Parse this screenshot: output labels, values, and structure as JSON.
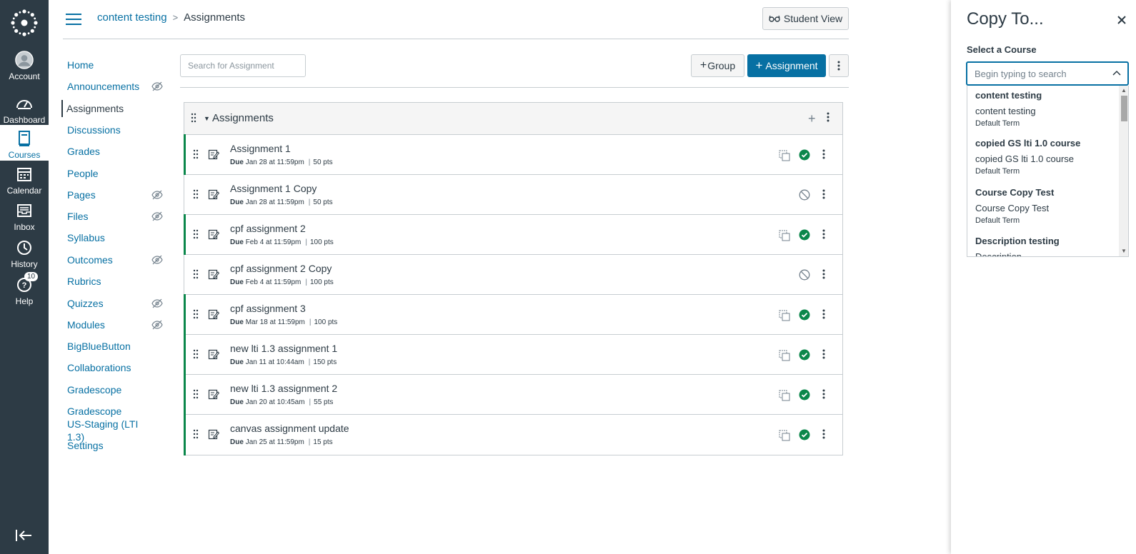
{
  "global_nav": {
    "items": [
      {
        "label": "Account",
        "icon": "account-icon"
      },
      {
        "label": "Dashboard",
        "icon": "dashboard-icon"
      },
      {
        "label": "Courses",
        "icon": "courses-icon",
        "active": true
      },
      {
        "label": "Calendar",
        "icon": "calendar-icon"
      },
      {
        "label": "Inbox",
        "icon": "inbox-icon"
      },
      {
        "label": "History",
        "icon": "history-icon"
      },
      {
        "label": "Help",
        "icon": "help-icon",
        "badge": "10"
      }
    ]
  },
  "header": {
    "breadcrumb_course": "content testing",
    "breadcrumb_separator": ">",
    "breadcrumb_page": "Assignments",
    "student_view_label": "Student View"
  },
  "course_nav": {
    "items": [
      {
        "label": "Home"
      },
      {
        "label": "Announcements",
        "hidden": true
      },
      {
        "label": "Assignments",
        "active": true
      },
      {
        "label": "Discussions"
      },
      {
        "label": "Grades"
      },
      {
        "label": "People"
      },
      {
        "label": "Pages",
        "hidden": true
      },
      {
        "label": "Files",
        "hidden": true
      },
      {
        "label": "Syllabus"
      },
      {
        "label": "Outcomes",
        "hidden": true
      },
      {
        "label": "Rubrics"
      },
      {
        "label": "Quizzes",
        "hidden": true
      },
      {
        "label": "Modules",
        "hidden": true
      },
      {
        "label": "BigBlueButton"
      },
      {
        "label": "Collaborations"
      },
      {
        "label": "Gradescope"
      },
      {
        "label": "Gradescope US-Staging (LTI 1.3)"
      },
      {
        "label": "Settings"
      }
    ]
  },
  "toolbar": {
    "search_placeholder": "Search for Assignment",
    "group_label": "Group",
    "assignment_label": "Assignment"
  },
  "assignment_group": {
    "title": "Assignments",
    "assignments": [
      {
        "title": "Assignment 1",
        "due_label": "Due",
        "due": "Jan 28 at 11:59pm",
        "points": "50 pts",
        "published": true
      },
      {
        "title": "Assignment 1 Copy",
        "due_label": "Due",
        "due": "Jan 28 at 11:59pm",
        "points": "50 pts",
        "published": false
      },
      {
        "title": "cpf assignment 2",
        "due_label": "Due",
        "due": "Feb 4 at 11:59pm",
        "points": "100 pts",
        "published": true
      },
      {
        "title": "cpf assignment 2 Copy",
        "due_label": "Due",
        "due": "Feb 4 at 11:59pm",
        "points": "100 pts",
        "published": false
      },
      {
        "title": "cpf assignment 3",
        "due_label": "Due",
        "due": "Mar 18 at 11:59pm",
        "points": "100 pts",
        "published": true
      },
      {
        "title": "new lti 1.3 assignment 1",
        "due_label": "Due",
        "due": "Jan 11 at 10:44am",
        "points": "150 pts",
        "published": true
      },
      {
        "title": "new lti 1.3 assignment 2",
        "due_label": "Due",
        "due": "Jan 20 at 10:45am",
        "points": "55 pts",
        "published": true
      },
      {
        "title": "canvas assignment update",
        "due_label": "Due",
        "due": "Jan 25 at 11:59pm",
        "points": "15 pts",
        "published": true
      }
    ]
  },
  "copy_tray": {
    "title": "Copy To...",
    "select_label": "Select a Course",
    "search_placeholder": "Begin typing to search",
    "options": [
      {
        "name": "content testing",
        "sub": "content testing",
        "term": "Default Term"
      },
      {
        "name": "copied GS lti 1.0 course",
        "sub": "copied GS lti 1.0 course",
        "term": "Default Term"
      },
      {
        "name": "Course Copy Test",
        "sub": "Course Copy Test",
        "term": "Default Term"
      },
      {
        "name": "Description testing",
        "sub": "Description...",
        "term": ""
      }
    ]
  },
  "colors": {
    "nav_bg": "#2d3b45",
    "link": "#0770a3",
    "published": "#0b874b",
    "border": "#c7cdd1"
  }
}
